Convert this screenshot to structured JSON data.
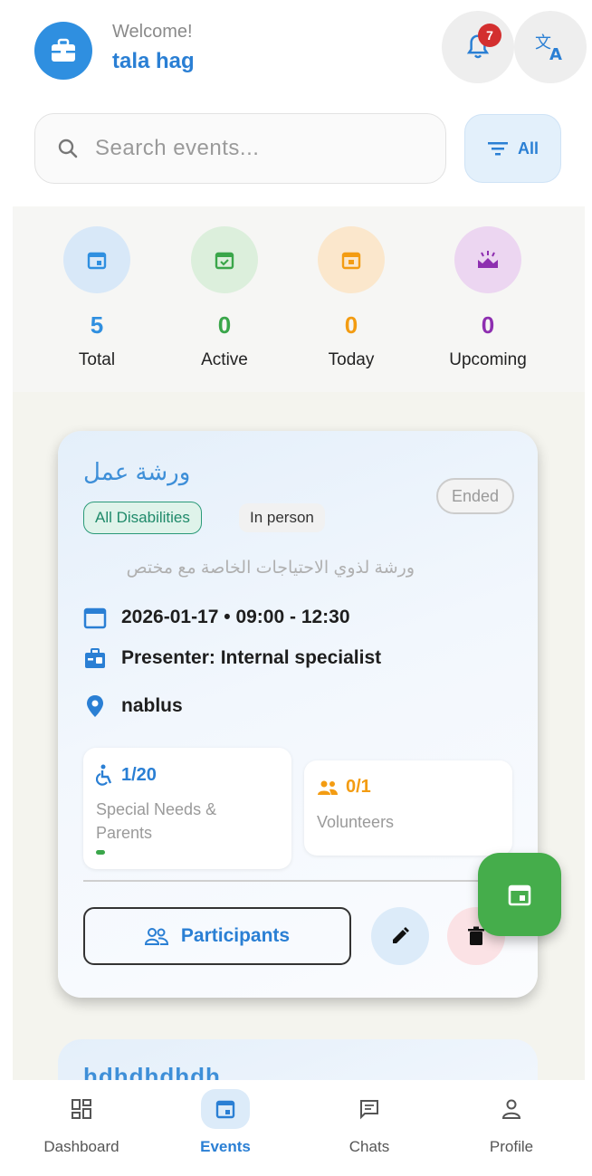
{
  "header": {
    "welcome": "Welcome!",
    "username": "tala hag",
    "notification_count": "7"
  },
  "search": {
    "placeholder": "Search events...",
    "filter_label": "All"
  },
  "stats": [
    {
      "value": "5",
      "label": "Total",
      "color": "#2f8fe0"
    },
    {
      "value": "0",
      "label": "Active",
      "color": "#3aa64a"
    },
    {
      "value": "0",
      "label": "Today",
      "color": "#f39c12"
    },
    {
      "value": "0",
      "label": "Upcoming",
      "color": "#8e2fb0"
    }
  ],
  "event_card": {
    "title": "ورشة عمل",
    "status": "Ended",
    "disability_tag": "All Disabilities",
    "mode_tag": "In person",
    "description": "ورشة لذوي الاحتياجات الخاصة مع مختص",
    "date_time": "2026-01-17 • 09:00 - 12:30",
    "presenter": "Presenter: Internal specialist",
    "location": "nablus",
    "special_needs": {
      "count": "1/20",
      "label": "Special Needs & Parents",
      "progress": 0.05
    },
    "volunteers": {
      "count": "0/1",
      "label": "Volunteers",
      "progress": 0
    },
    "participants_label": "Participants"
  },
  "second_card": {
    "title": "hdhdhdhdh"
  },
  "nav": [
    {
      "label": "Dashboard",
      "icon": "dashboard-icon"
    },
    {
      "label": "Events",
      "icon": "calendar-icon",
      "active": true
    },
    {
      "label": "Chats",
      "icon": "chat-icon"
    },
    {
      "label": "Profile",
      "icon": "person-icon"
    }
  ],
  "colors": {
    "primary": "#2a7fd4",
    "fab": "#45ad4b",
    "delete": "#d32f2f"
  }
}
